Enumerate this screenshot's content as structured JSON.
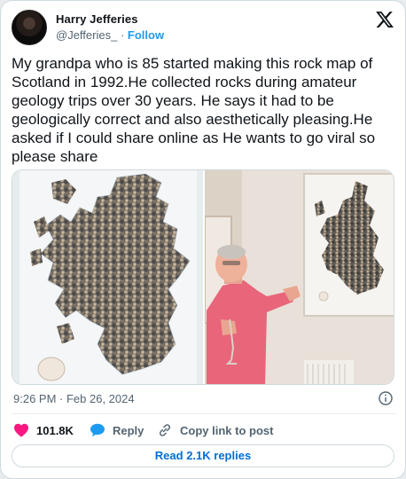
{
  "author": {
    "name": "Harry Jefferies",
    "handle": "@Jefferies_",
    "separator": "·",
    "follow_label": "Follow"
  },
  "logo_icon": "x-logo-icon",
  "tweet": {
    "text": "My grandpa who is 85 started making this rock map of Scotland in 1992.He collected rocks during amateur geology trips over 30 years. He says it had to be geologically correct and also aesthetically pleasing.He asked if I could share online as He wants to go viral so please share"
  },
  "media": {
    "photos": [
      "rock-map-of-scotland-photo",
      "grandpa-pointing-at-map-photo"
    ]
  },
  "meta": {
    "timestamp": "9:26 PM · Feb 26, 2024",
    "info_icon": "info-icon"
  },
  "actions": {
    "likes_count": "101.8K",
    "reply_label": "Reply",
    "copy_label": "Copy link to post"
  },
  "replies_button": {
    "label": "Read 2.1K replies"
  },
  "colors": {
    "accent": "#1d9bf0",
    "like_red": "#f91880",
    "reply_blue": "#1d9bf0",
    "text": "#0f1419",
    "secondary": "#536471"
  }
}
